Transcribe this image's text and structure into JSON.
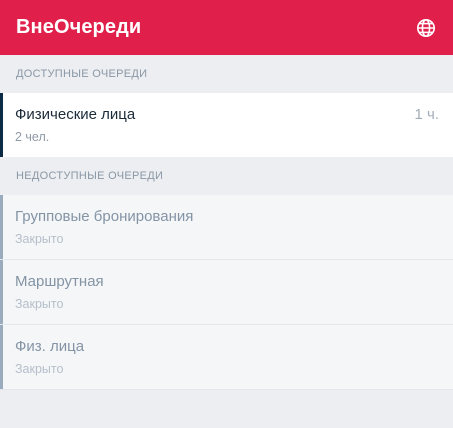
{
  "header": {
    "title": "ВнеОчереди",
    "language_icon": "globe-icon"
  },
  "available_section": {
    "title": "ДОСТУПНЫЕ ОЧЕРЕДИ",
    "queues": [
      {
        "name": "Физические лица",
        "people": "2 чел.",
        "wait": "1 ч."
      }
    ]
  },
  "unavailable_section": {
    "title": "НЕДОСТУПНЫЕ ОЧЕРЕДИ",
    "queues": [
      {
        "name": "Групповые бронирования",
        "status": "Закрыто"
      },
      {
        "name": "Маршрутная",
        "status": "Закрыто"
      },
      {
        "name": "Физ. лица",
        "status": "Закрыто"
      }
    ]
  },
  "colors": {
    "brand": "#e0204b",
    "available_accent": "#0b2a44",
    "unavailable_accent": "#9aabbd",
    "background": "#eceef1"
  }
}
